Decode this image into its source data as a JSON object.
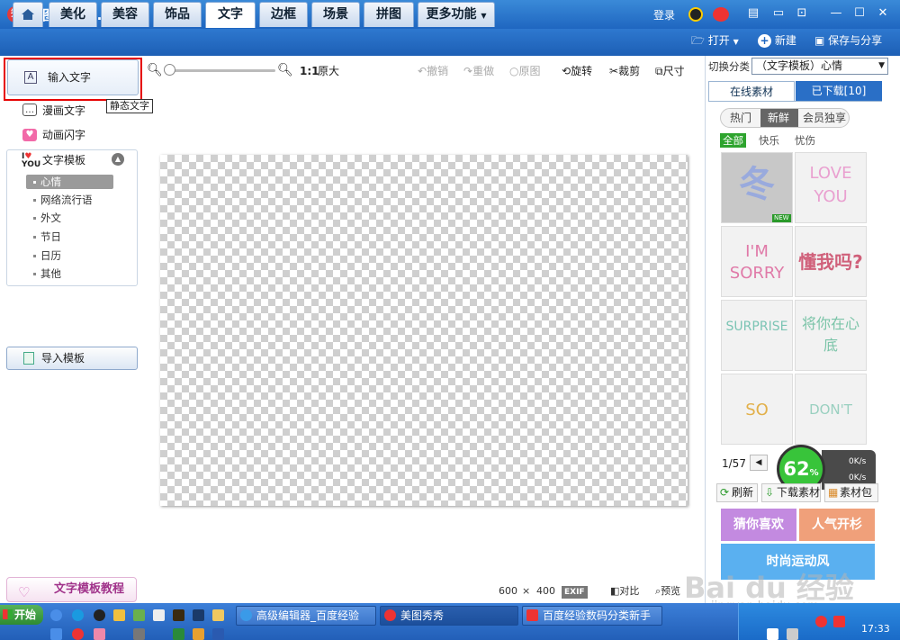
{
  "window": {
    "title": "美图秀秀 3.9.6",
    "logo_text": "秀",
    "login": "登录"
  },
  "tabs": [
    "美化",
    "美容",
    "饰品",
    "文字",
    "边框",
    "场景",
    "拼图",
    "更多功能"
  ],
  "top_actions": {
    "open": "打开",
    "new": "新建",
    "save_share": "保存与分享"
  },
  "left": {
    "input_text": "输入文字",
    "tooltip": "静态文字",
    "comic_text": "漫画文字",
    "flash_text": "动画闪字",
    "templates_title": "文字模板",
    "subitems": [
      "心情",
      "网络流行语",
      "外文",
      "节日",
      "日历",
      "其他"
    ],
    "import_template": "导入模板",
    "tutorial": "文字模板教程"
  },
  "toolbar": {
    "ratio": "1:1",
    "original_size": "原大",
    "undo": "撤销",
    "redo": "重做",
    "original_image": "原图",
    "rotate": "旋转",
    "crop": "裁剪",
    "size": "尺寸"
  },
  "canvas_status": {
    "width": "600",
    "times": "×",
    "height": "400",
    "exif": "EXIF",
    "compare": "对比",
    "preview": "预览"
  },
  "right": {
    "switch_label": "切换分类",
    "switch_value": "（文字模板）心情",
    "tab_online": "在线素材",
    "tab_downloaded": "已下载[10]",
    "filters": [
      "热门",
      "新鲜",
      "会员独享"
    ],
    "categories": [
      "全部",
      "快乐",
      "忧伤"
    ],
    "thumbs": [
      "冬",
      "LOVE YOU",
      "I'M SORRY",
      "懂我吗?",
      "SURPRISE",
      "将你在心底",
      "SO COOL",
      "DON'T CRY"
    ],
    "new_badge": "NEW",
    "page": "1/57",
    "percent": "62",
    "percent_sign": "%",
    "net_up": "0K/s",
    "net_down": "0K/s",
    "refresh": "刷新",
    "download": "下载素材",
    "pack": "素材包",
    "banner1": "猜你喜欢",
    "banner2": "人气开杉",
    "banner3": "时尚运动风"
  },
  "taskbar": {
    "start": "开始",
    "tasks": [
      "高级编辑器_百度经验",
      "美图秀秀",
      "百度经验数码分类新手"
    ],
    "clock": "17:33"
  },
  "watermark": {
    "logo": "Bai du 经验",
    "url": "jingyan.baidu.com"
  },
  "colors": {
    "titlebar": "#1f66c0",
    "highlight": "#e60000",
    "percent": "#38c43a"
  }
}
